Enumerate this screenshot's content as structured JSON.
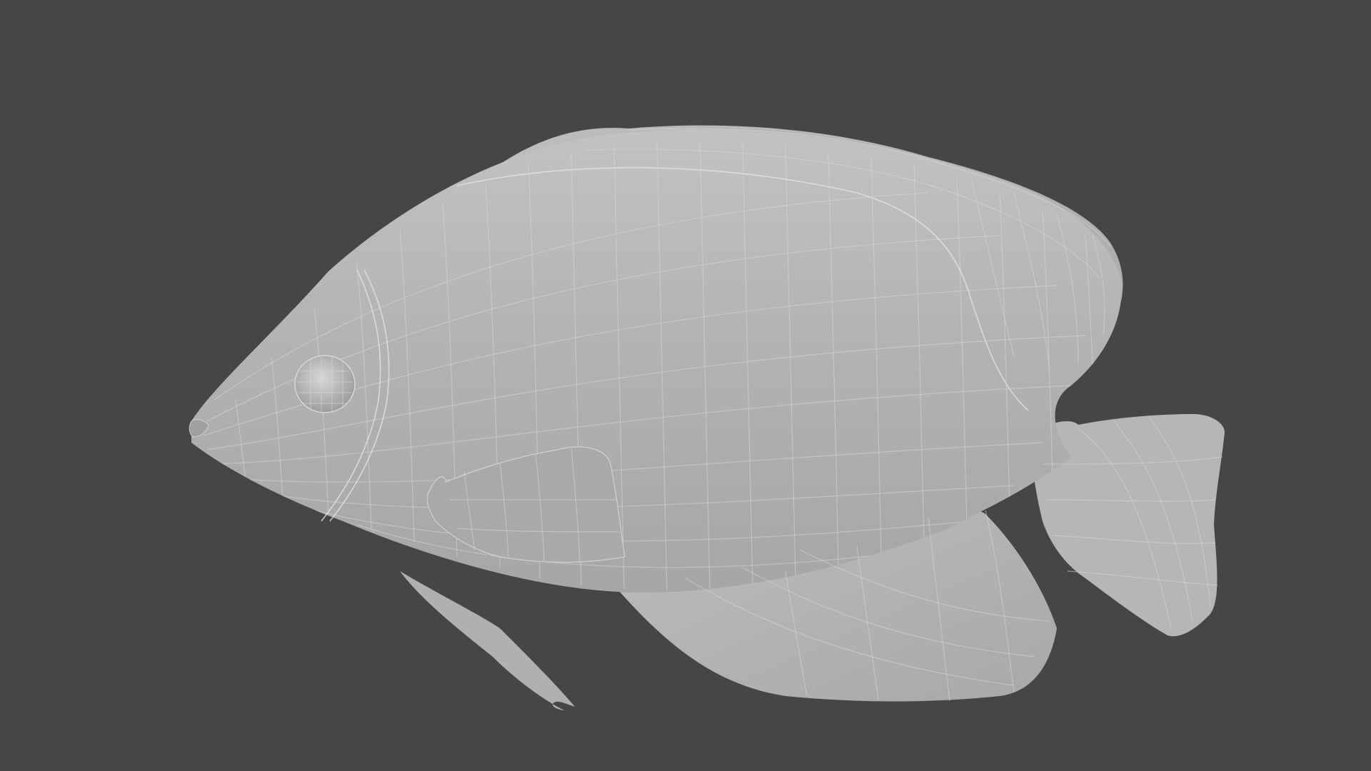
{
  "viewport": {
    "background_color": "#464646",
    "subject": "fish-wireframe-model",
    "shading": "solid-gray-with-wireframe",
    "model_color": "#b4b4b4",
    "wire_color": "#d6d6d6"
  }
}
